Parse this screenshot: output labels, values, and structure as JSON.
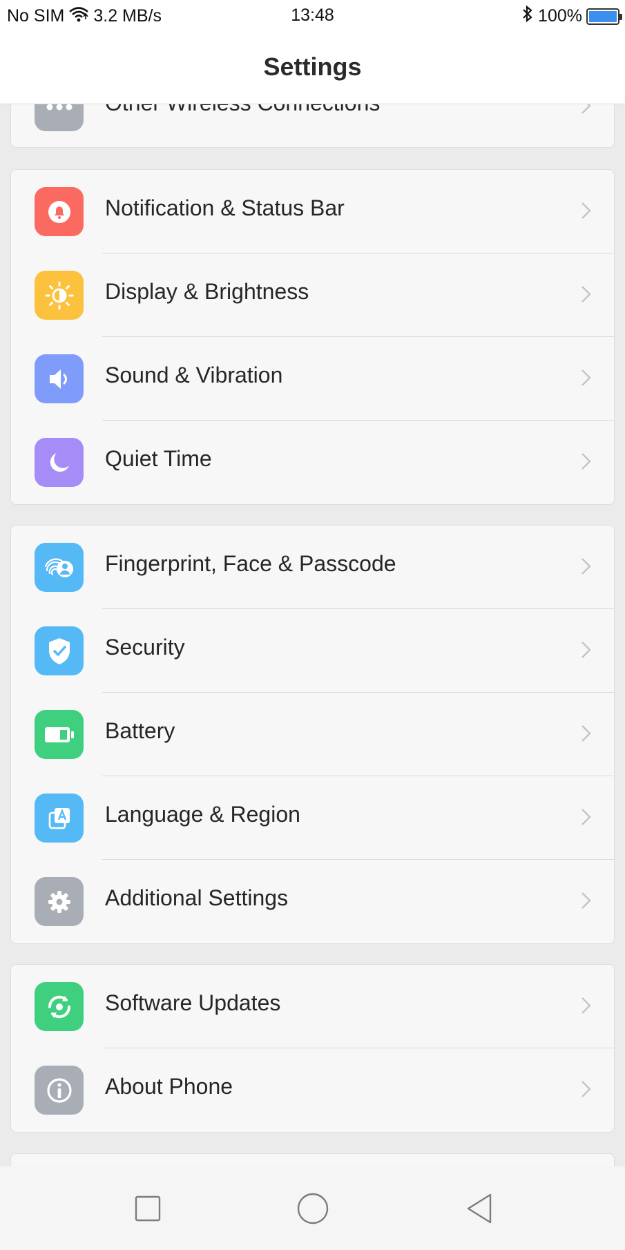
{
  "status_bar": {
    "carrier": "No SIM",
    "speed": "3.2 MB/s",
    "time": "13:48",
    "battery": "100%",
    "battery_level": 1.0,
    "icons": [
      "wifi-icon",
      "bluetooth-icon",
      "battery-icon"
    ]
  },
  "header": {
    "title": "Settings"
  },
  "partial_row": {
    "label": "Other Wireless Connections",
    "icon": "more-dots-icon",
    "color": "#a9adb5"
  },
  "groups": [
    {
      "items": [
        {
          "label": "Notification & Status Bar",
          "icon": "bell-icon",
          "color": "#fb6a60"
        },
        {
          "label": "Display & Brightness",
          "icon": "brightness-icon",
          "color": "#fcc23e"
        },
        {
          "label": "Sound & Vibration",
          "icon": "speaker-icon",
          "color": "#7f9cfb"
        },
        {
          "label": "Quiet Time",
          "icon": "moon-icon",
          "color": "#a58cf7"
        }
      ]
    },
    {
      "items": [
        {
          "label": "Fingerprint, Face & Passcode",
          "icon": "fingerprint-face-icon",
          "color": "#55b9f6"
        },
        {
          "label": "Security",
          "icon": "shield-icon",
          "color": "#55b9f6"
        },
        {
          "label": "Battery",
          "icon": "battery-setting-icon",
          "color": "#3ed07e"
        },
        {
          "label": "Language & Region",
          "icon": "language-icon",
          "color": "#55b9f6"
        },
        {
          "label": "Additional Settings",
          "icon": "gear-icon",
          "color": "#a9adb5"
        }
      ]
    },
    {
      "items": [
        {
          "label": "Software Updates",
          "icon": "update-icon",
          "color": "#3ed07e"
        },
        {
          "label": "About Phone",
          "icon": "info-icon",
          "color": "#a9adb5"
        }
      ]
    }
  ],
  "navbar": {
    "buttons": [
      "recents-icon",
      "home-icon",
      "back-icon"
    ]
  }
}
